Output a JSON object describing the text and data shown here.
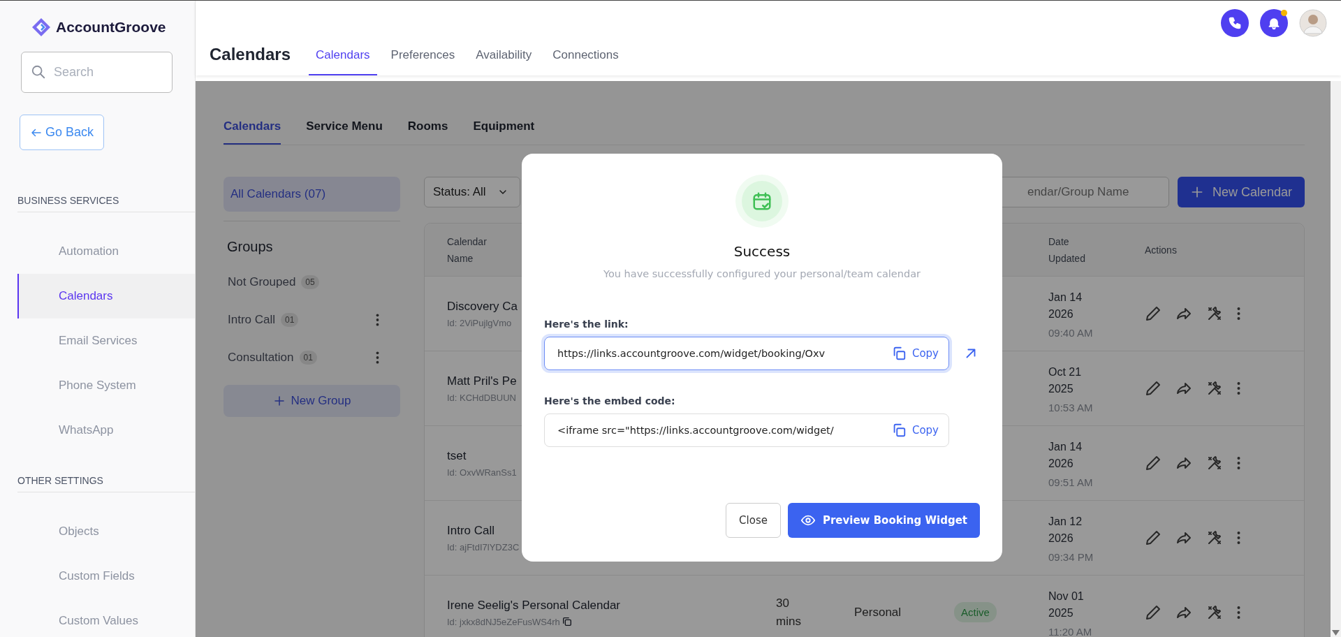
{
  "sidebar": {
    "logo": "AccountGroove",
    "search": {
      "placeholder": "Search"
    },
    "back_button": "Go Back",
    "sections": [
      {
        "title": "BUSINESS SERVICES",
        "items": [
          {
            "label": "Automation",
            "selected": false
          },
          {
            "label": "Calendars",
            "selected": true
          },
          {
            "label": "Email Services",
            "selected": false
          },
          {
            "label": "Phone System",
            "selected": false
          },
          {
            "label": "WhatsApp",
            "selected": false
          }
        ]
      },
      {
        "title": "OTHER SETTINGS",
        "items": [
          {
            "label": "Objects",
            "selected": false
          },
          {
            "label": "Custom Fields",
            "selected": false
          },
          {
            "label": "Custom Values",
            "selected": false
          }
        ]
      }
    ]
  },
  "header": {
    "title": "Calendars",
    "tabs": [
      {
        "label": "Calendars",
        "selected": true
      },
      {
        "label": "Preferences",
        "selected": false
      },
      {
        "label": "Availability",
        "selected": false
      },
      {
        "label": "Connections",
        "selected": false
      }
    ],
    "notification_dot": true
  },
  "sub_tabs": [
    {
      "label": "Calendars",
      "selected": true
    },
    {
      "label": "Service Menu",
      "selected": false
    },
    {
      "label": "Rooms",
      "selected": false
    },
    {
      "label": "Equipment",
      "selected": false
    }
  ],
  "groups_panel": {
    "all": {
      "label": "All Calendars (07)",
      "selected": true
    },
    "title": "Groups",
    "groups": [
      {
        "name": "Not Grouped",
        "count": "05"
      },
      {
        "name": "Intro Call",
        "count": "01",
        "menu": true
      },
      {
        "name": "Consultation",
        "count": "01",
        "menu": true
      }
    ],
    "new_group": "New Group"
  },
  "toolbar": {
    "status_filter": "Status: All",
    "search_placeholder": "endar/Group Name",
    "new_button": "New Calendar"
  },
  "table": {
    "columns": [
      "Calendar Name",
      "Date Updated",
      "Actions"
    ],
    "rows": [
      {
        "name": "Discovery Ca",
        "id": "Id: 2ViPujlgVmo",
        "date": "Jan 14 2026",
        "time": "09:40 AM"
      },
      {
        "name": "Matt Pril's Pe",
        "id": "Id: KCHdDBUUN",
        "date": "Oct 21 2025",
        "time": "10:53 AM"
      },
      {
        "name": "tset",
        "id": "Id: OxvWRanSs1",
        "date": "Jan 14 2026",
        "time": "09:51 AM"
      },
      {
        "name": "Intro Call",
        "id": "Id: ajFtdI7lYDZ3C",
        "date": "Jan 12 2026",
        "time": "09:34 PM"
      },
      {
        "name": "Irene Seelig's Personal Calendar",
        "id": "Id: jxkx8dNJ5eZeFusWS4rh",
        "copyable": true,
        "duration": "30 mins",
        "type": "Personal",
        "status": "Active",
        "date": "Nov 01 2025",
        "time": "11:20 AM"
      }
    ]
  },
  "modal": {
    "title": "Success",
    "message": "You have successfully configured your personal/team calendar",
    "fields": [
      {
        "label": "Here's the link:",
        "value": "https://links.accountgroove.com/widget/booking/Oxv",
        "copy": "Copy",
        "focused": true,
        "external_link": true
      },
      {
        "label": "Here's the embed code:",
        "value": "<iframe src=\"https://links.accountgroove.com/widget/",
        "copy": "Copy",
        "focused": false
      }
    ],
    "close": "Close",
    "preview": "Preview Booking Widget"
  }
}
